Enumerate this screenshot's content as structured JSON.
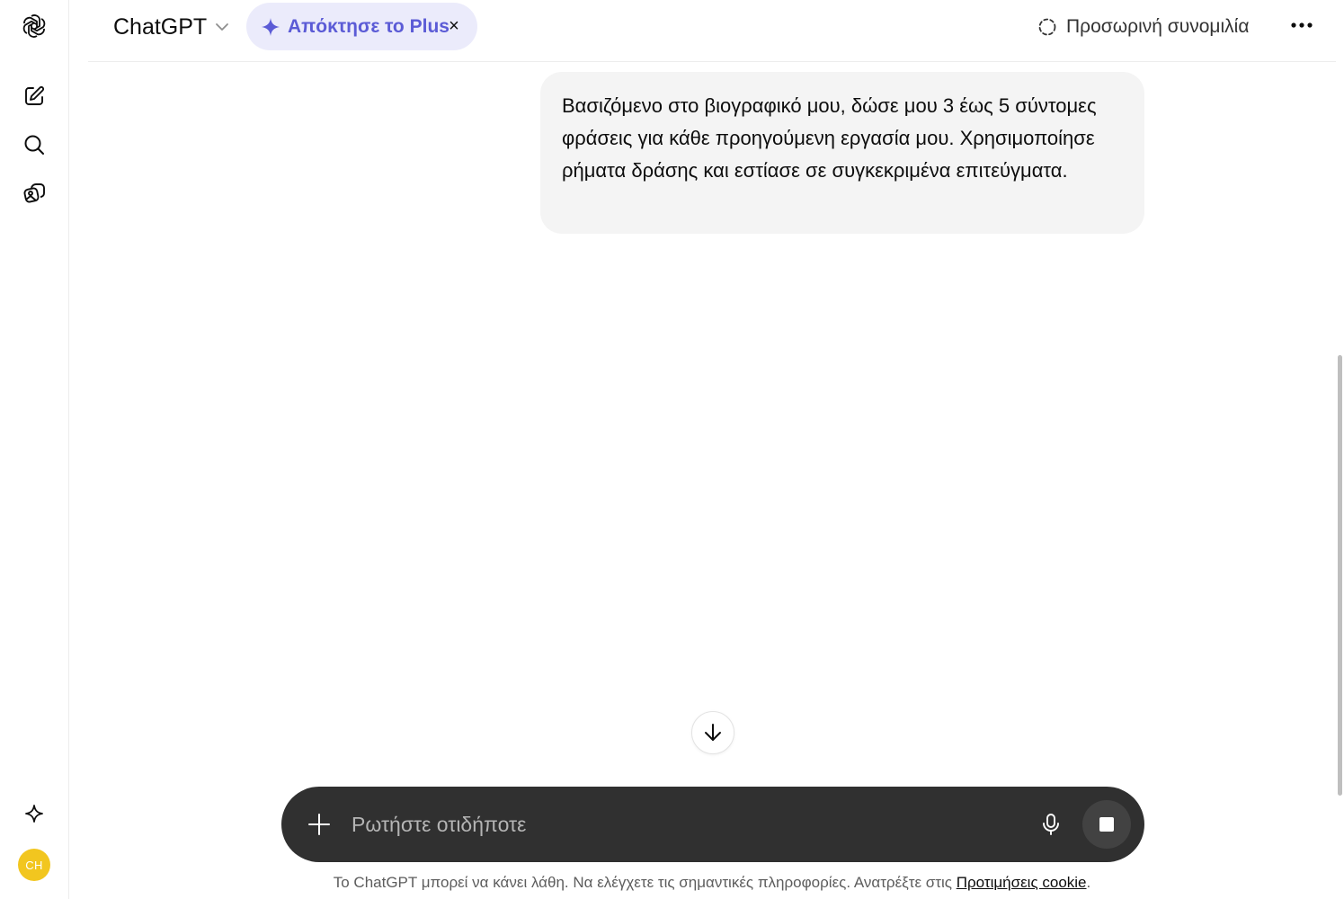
{
  "header": {
    "model_name": "ChatGPT",
    "upgrade_label": "Απόκτησε το Plus",
    "upgrade_close": "×",
    "temp_chat_label": "Προσωρινή συνομιλία"
  },
  "sidebar": {
    "icons": [
      "openai-logo-icon",
      "new-chat-icon",
      "search-icon",
      "library-icon",
      "explore-icon"
    ],
    "avatar_initials": "CH",
    "avatar_color": "#f2c61f"
  },
  "conversation": {
    "user_message": "Βασιζόμενο στο βιογραφικό μου, δώσε μου 3 έως 5 σύντομες φράσεις για κάθε προηγούμενη εργασία μου. Χρησιμοποίησε ρήματα δράσης και εστίασε σε συγκεκριμένα επιτεύγματα."
  },
  "composer": {
    "placeholder": "Ρωτήστε οτιδήποτε"
  },
  "footer": {
    "disclaimer": "Το ChatGPT μπορεί να κάνει λάθη. Να ελέγχετε τις σημαντικές πληροφορίες. Ανατρέξτε στις ",
    "cookie_link": "Προτιμήσεις cookie",
    "trailing": "."
  },
  "colors": {
    "accent": "#5b5bd6",
    "upgrade_bg": "#ebebfb",
    "composer_bg": "#303030",
    "bubble_bg": "#f4f4f4"
  }
}
